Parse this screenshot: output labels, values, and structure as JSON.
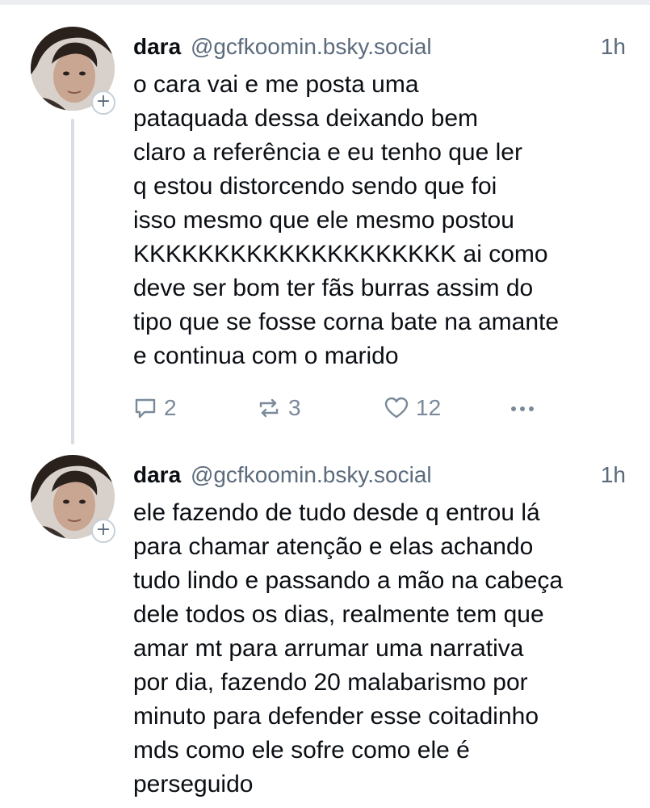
{
  "posts": [
    {
      "author": {
        "name": "dara",
        "handle": "@gcfkoomin.bsky.social"
      },
      "time": "1h",
      "lines": [
        "o cara vai e me posta uma",
        "pataquada dessa deixando bem",
        "claro a referência e eu tenho que ler",
        "q estou distorcendo sendo que foi",
        "isso mesmo que ele mesmo postou",
        "KKKKKKKKKKKKKKKKKKKK ai como",
        "deve ser bom ter fãs burras assim do",
        "tipo que se fosse corna bate na amante",
        "e continua com o marido"
      ],
      "stats": {
        "replies": "2",
        "reposts": "3",
        "likes": "12"
      }
    },
    {
      "author": {
        "name": "dara",
        "handle": "@gcfkoomin.bsky.social"
      },
      "time": "1h",
      "lines": [
        "ele fazendo de tudo desde q entrou lá",
        "para chamar atenção e elas achando",
        "tudo lindo e passando a mão na cabeça",
        "dele todos os dias, realmente tem que",
        "amar mt para arrumar uma narrativa",
        "por dia, fazendo 20 malabarismo por",
        "minuto para defender esse coitadinho",
        "mds como ele sofre como ele é",
        "perseguido"
      ]
    }
  ],
  "icons": {
    "follow": "plus-icon",
    "reply": "speech-bubble-icon",
    "repost": "repost-arrows-icon",
    "like": "heart-icon",
    "more": "ellipsis-icon"
  },
  "colors": {
    "text": "#0b0f14",
    "muted": "#5b6b7c",
    "action": "#7b8a9a",
    "thread_line": "#d8dde3"
  }
}
